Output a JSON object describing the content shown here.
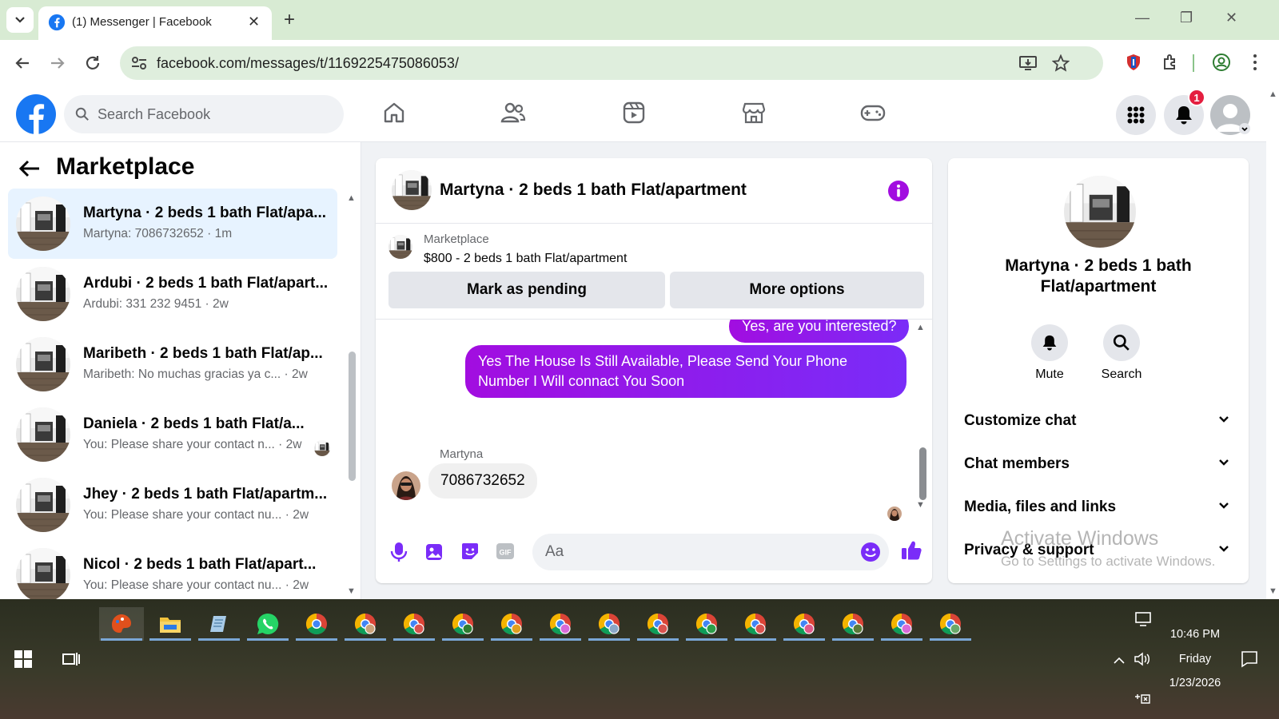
{
  "browser": {
    "tab_title": "(1) Messenger | Facebook",
    "url": "facebook.com/messages/t/1169225475086053/"
  },
  "fb": {
    "search_placeholder": "Search Facebook",
    "notification_count": "1",
    "brand_color": "#1877f2"
  },
  "marketplace": {
    "title": "Marketplace",
    "conversations": [
      {
        "name": "Martyna · 2 beds 1 bath Flat/apa...",
        "preview": "Martyna: 7086732652 · 1m",
        "active": true
      },
      {
        "name": "Ardubi · 2 beds 1 bath Flat/apart...",
        "preview": "Ardubi: 331 232 9451 · 2w"
      },
      {
        "name": "Maribeth · 2 beds 1 bath Flat/ap...",
        "preview": "Maribeth: No muchas gracias ya c...  · 2w"
      },
      {
        "name": "Daniela · 2 beds 1 bath Flat/a...",
        "preview": "You: Please share your contact n... · 2w"
      },
      {
        "name": "Jhey · 2 beds 1 bath Flat/apartm...",
        "preview": "You: Please share your contact nu...  · 2w"
      },
      {
        "name": "Nicol · 2 beds 1 bath Flat/apart...",
        "preview": "You: Please share your contact nu...  · 2w"
      }
    ]
  },
  "chat": {
    "title": "Martyna · 2 beds 1 bath Flat/apartment",
    "listing_source": "Marketplace",
    "listing_price": "$800 - 2 beds 1 bath Flat/apartment",
    "mark_pending_label": "Mark as pending",
    "more_options_label": "More options",
    "messages": [
      {
        "from": "me",
        "text": "Yes, are you interested?"
      },
      {
        "from": "me",
        "text": "Yes The House Is Still Available, Please Send Your Phone Number I Will connact You Soon"
      },
      {
        "from": "Martyna",
        "sender_label": "Martyna",
        "text": "7086732652"
      }
    ],
    "input_placeholder": "Aa",
    "accent_color": "#a20de0"
  },
  "info_panel": {
    "name": "Martyna · 2 beds 1 bath Flat/apartment",
    "mute_label": "Mute",
    "search_label": "Search",
    "sections": [
      "Customize chat",
      "Chat members",
      "Media, files and links",
      "Privacy & support"
    ]
  },
  "watermark": {
    "line1": "Activate Windows",
    "line2": "Go to Settings to activate Windows."
  },
  "taskbar": {
    "time": "10:46 PM",
    "day": "Friday",
    "date": "1/23/2026"
  }
}
